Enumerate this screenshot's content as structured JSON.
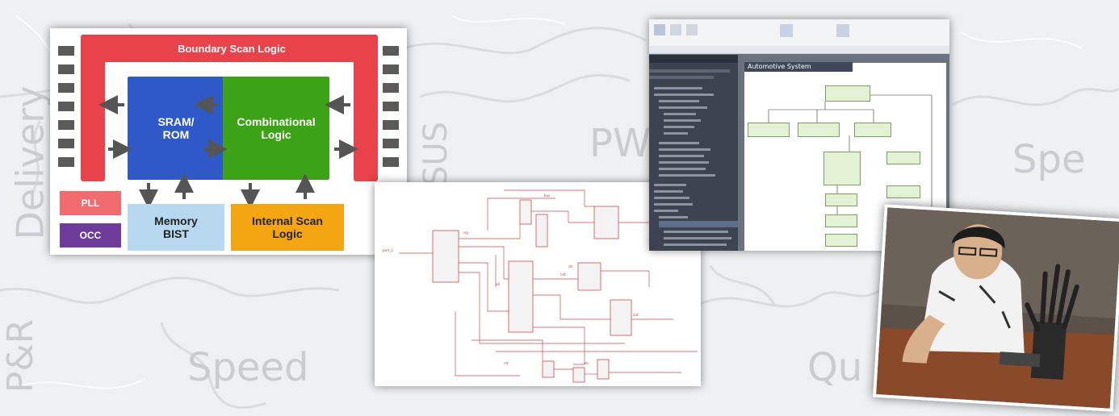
{
  "background": {
    "words": [
      "Delivery",
      "PW",
      "Spe",
      "P&R",
      "Speed",
      "Qu",
      "SUS"
    ]
  },
  "boundary_scan": {
    "boundary_label": "Boundary Scan Logic",
    "sram_label": "SRAM/\nROM",
    "comb_label": "Combinational\nLogic",
    "pll_label": "PLL",
    "occ_label": "OCC",
    "bist_label": "Memory\nBIST",
    "internal_scan_label": "Internal Scan\nLogic",
    "colors": {
      "boundary": "#e8424a",
      "sram": "#2f59c9",
      "comb": "#3da316",
      "pll": "#f06b6e",
      "occ": "#6e3c9a",
      "bist": "#b8d8f0",
      "internal": "#f4a512",
      "pin": "#5a5a5a",
      "arrow": "#555555"
    }
  },
  "ea_window": {
    "tab_title": "Automotive System Requirements"
  },
  "photo": {
    "colors": {
      "bg": "#5b5148",
      "table": "#8a4a2a"
    }
  }
}
